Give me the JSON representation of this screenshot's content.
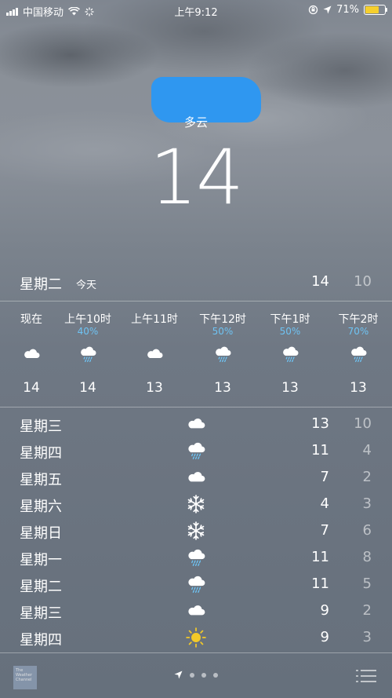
{
  "status_bar": {
    "carrier": "中国移动",
    "time": "上午9:12",
    "battery_percent": "71%",
    "battery_level": 0.71,
    "battery_color": "#f5cf2e"
  },
  "header": {
    "location_redacted_color": "#2f97f0",
    "condition": "多云",
    "temperature": "14"
  },
  "today": {
    "day": "星期二",
    "tag": "今天",
    "high": "14",
    "low": "10"
  },
  "hourly": [
    {
      "time": "现在",
      "precip": "",
      "icon": "cloud-icon",
      "temp": "14"
    },
    {
      "time": "上午10时",
      "precip": "40%",
      "icon": "cloud-rain-icon",
      "temp": "14"
    },
    {
      "time": "上午11时",
      "precip": "",
      "icon": "cloud-icon",
      "temp": "13"
    },
    {
      "time": "下午12时",
      "precip": "50%",
      "icon": "cloud-rain-icon",
      "temp": "13"
    },
    {
      "time": "下午1时",
      "precip": "50%",
      "icon": "cloud-rain-icon",
      "temp": "13"
    },
    {
      "time": "下午2时",
      "precip": "70%",
      "icon": "cloud-rain-icon",
      "temp": "13"
    }
  ],
  "daily": [
    {
      "day": "星期三",
      "icon": "cloud-icon",
      "high": "13",
      "low": "10"
    },
    {
      "day": "星期四",
      "icon": "cloud-rain-icon",
      "high": "11",
      "low": "4"
    },
    {
      "day": "星期五",
      "icon": "cloud-icon",
      "high": "7",
      "low": "2"
    },
    {
      "day": "星期六",
      "icon": "snowflake-icon",
      "high": "4",
      "low": "3"
    },
    {
      "day": "星期日",
      "icon": "snowflake-icon",
      "high": "7",
      "low": "6"
    },
    {
      "day": "星期一",
      "icon": "cloud-rain-icon",
      "high": "11",
      "low": "8"
    },
    {
      "day": "星期二",
      "icon": "cloud-rain-icon",
      "high": "11",
      "low": "5"
    },
    {
      "day": "星期三",
      "icon": "cloud-icon",
      "high": "9",
      "low": "2"
    },
    {
      "day": "星期四",
      "icon": "sun-icon",
      "high": "9",
      "low": "3"
    }
  ],
  "bottom_bar": {
    "logo_text": "The Weather Channel",
    "page_count": 3
  },
  "colors": {
    "precip": "#6ec3f3",
    "sun": "#f3c928"
  }
}
